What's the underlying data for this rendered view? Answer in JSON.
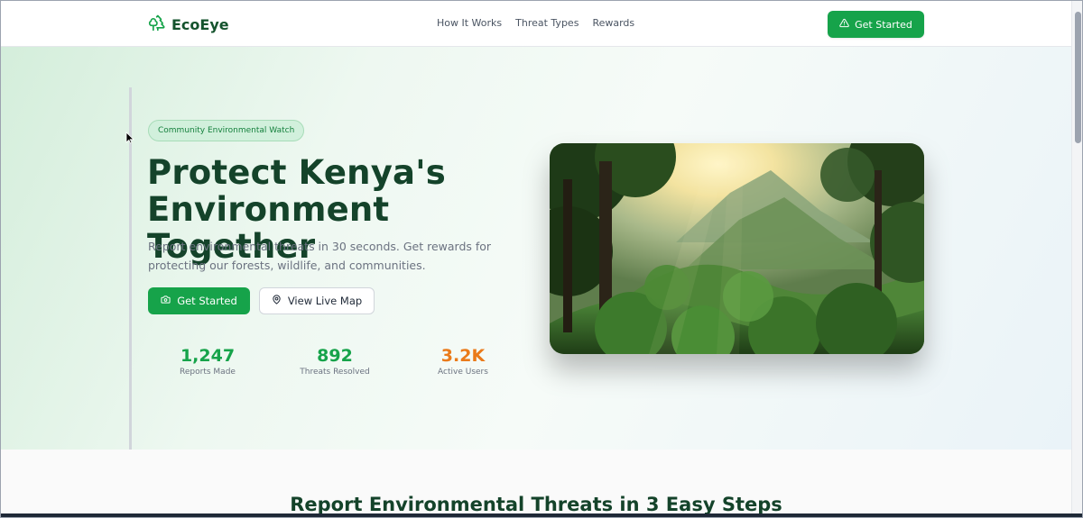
{
  "brand": {
    "name": "EcoEye",
    "logo_icon": "trees-icon",
    "primary_color": "#16a34a",
    "dark_green": "#14432a",
    "accent_orange": "#ea7a1a"
  },
  "nav": {
    "links": [
      "How It Works",
      "Threat Types",
      "Rewards"
    ],
    "cta_label": "Get Started",
    "cta_icon": "alert-triangle-icon"
  },
  "hero": {
    "badge": "Community Environmental Watch",
    "headline_line1": "Protect Kenya's",
    "headline_line2": "Environment Together",
    "subtext": "Report environmental threats in 30 seconds. Get rewards for protecting our forests, wildlife, and communities.",
    "primary_button": {
      "label": "Get Started",
      "icon": "camera-icon"
    },
    "secondary_button": {
      "label": "View Live Map",
      "icon": "map-pin-icon"
    },
    "stats": [
      {
        "value": "1,247",
        "label": "Reports Made"
      },
      {
        "value": "892",
        "label": "Threats Resolved"
      },
      {
        "value": "3.2K",
        "label": "Active Users"
      }
    ]
  },
  "section2": {
    "title": "Report Environmental Threats in 3 Easy Steps"
  }
}
